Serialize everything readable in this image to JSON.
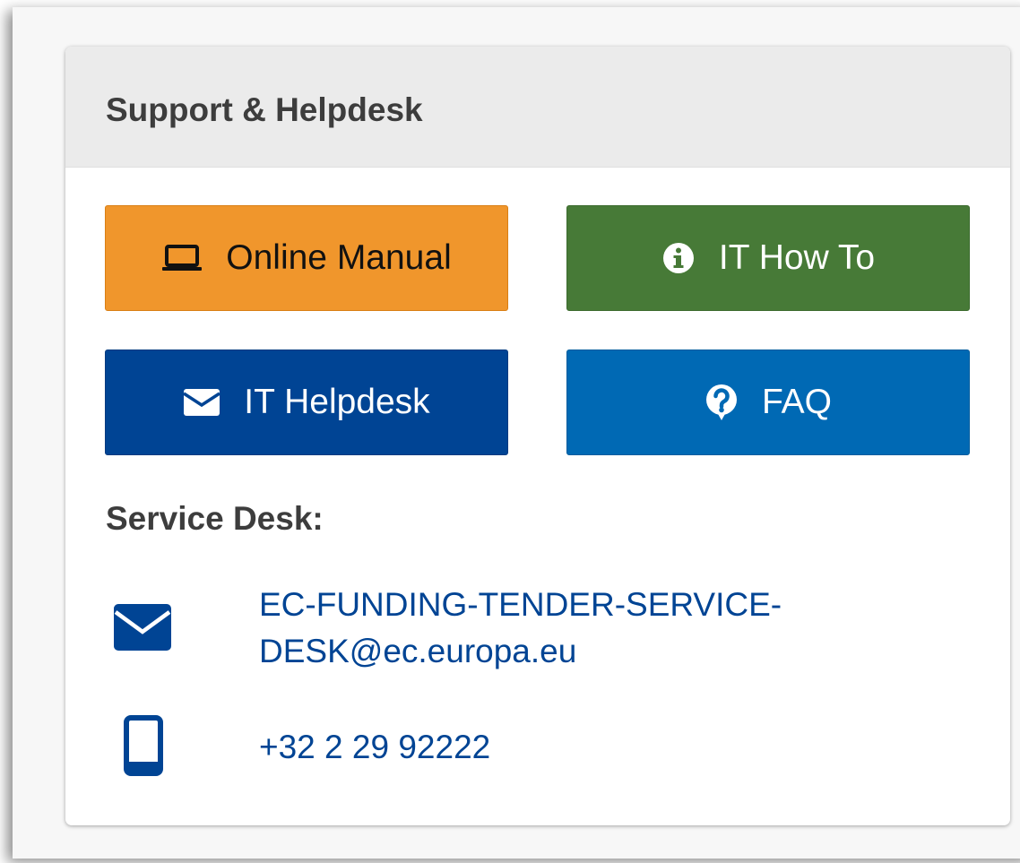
{
  "panel": {
    "title": "Support & Helpdesk"
  },
  "buttons": {
    "online_manual": {
      "label": "Online Manual",
      "icon": "laptop-icon",
      "color": "#f0962c"
    },
    "it_how_to": {
      "label": "IT How To",
      "icon": "info-circle-icon",
      "color": "#477a37"
    },
    "it_helpdesk": {
      "label": "IT Helpdesk",
      "icon": "envelope-icon",
      "color": "#004494"
    },
    "faq": {
      "label": "FAQ",
      "icon": "question-bubble-icon",
      "color": "#0069b4"
    }
  },
  "service_desk": {
    "label": "Service Desk:",
    "email_line1": "EC-FUNDING-TENDER-SERVICE-",
    "email_line2": "DESK@ec.europa.eu",
    "email_icon": "envelope-icon",
    "phone": "+32 2 29 92222",
    "phone_icon": "mobile-phone-icon",
    "link_color": "#004494"
  }
}
